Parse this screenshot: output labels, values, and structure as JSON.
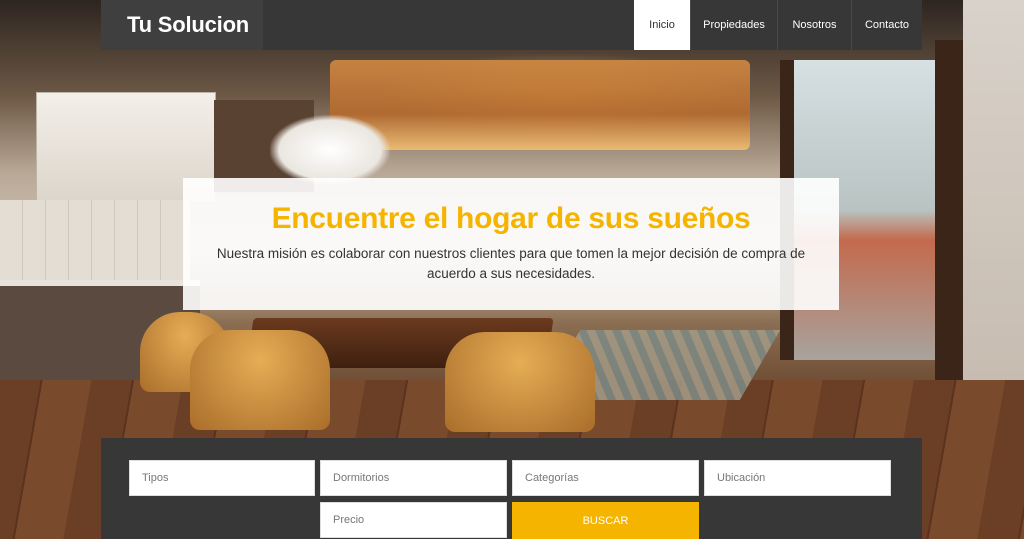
{
  "brand": {
    "name": "Tu Solucion"
  },
  "nav": {
    "items": [
      {
        "label": "Inicio",
        "active": true
      },
      {
        "label": "Propiedades",
        "active": false
      },
      {
        "label": "Nosotros",
        "active": false
      },
      {
        "label": "Contacto",
        "active": false
      }
    ]
  },
  "hero": {
    "title": "Encuentre el hogar de sus sueños",
    "subtitle": "Nuestra misión es colaborar con nuestros clientes para que tomen la mejor decisión de compra de acuerdo a sus necesidades."
  },
  "search": {
    "tipos_placeholder": "Tipos",
    "dormitorios_placeholder": "Dormitorios",
    "categorias_placeholder": "Categorías",
    "ubicacion_placeholder": "Ubicación",
    "precio_placeholder": "Precio",
    "buscar_label": "BUSCAR"
  },
  "colors": {
    "accent": "#f5b400",
    "navbar": "#373737",
    "brand_bg": "#3f3f3f"
  }
}
